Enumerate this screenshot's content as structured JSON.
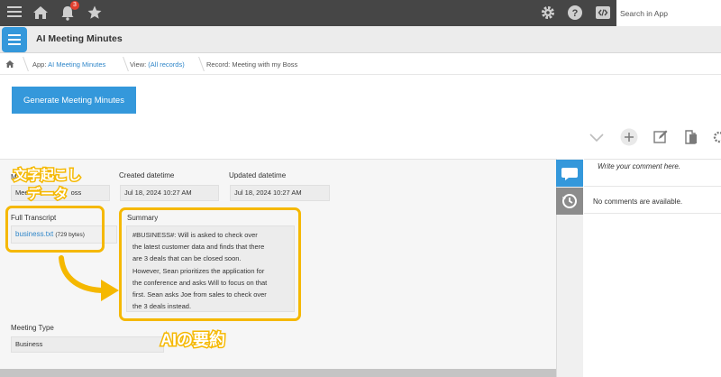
{
  "topbar": {
    "notification_count": "3",
    "search_placeholder": "Search in App",
    "icons": [
      "menu-icon",
      "home-icon",
      "bell-icon",
      "star-icon",
      "gear-icon",
      "help-icon",
      "code-icon"
    ]
  },
  "app": {
    "title": "AI Meeting Minutes",
    "accent_color": "#3498db"
  },
  "breadcrumb": {
    "app_prefix": "App: ",
    "app_name": "AI Meeting Minutes",
    "view_prefix": "View: ",
    "view_name": "(All records)",
    "record": "Record: Meeting with my Boss"
  },
  "actions": {
    "generate_label": "Generate Meeting Minutes"
  },
  "record": {
    "title_label_visible": "M",
    "title_value_visible": "Mee",
    "title_value_tail": "oss",
    "created_label": "Created datetime",
    "created_value": "Jul 18, 2024 10:27 AM",
    "updated_label": "Updated datetime",
    "updated_value": "Jul 18, 2024 10:27 AM",
    "transcript_label": "Full Transcript",
    "transcript_file": "business.txt",
    "transcript_size": "(729 bytes)",
    "summary_label": "Summary",
    "summary_lines": [
      "#BUSINESS#: Will is asked to check over",
      "the latest customer data and finds that there",
      "are 3 deals that can be closed soon.",
      "However, Sean prioritizes the application for",
      "the conference and asks Will to focus on that",
      "first. Sean asks Joe from sales to check over",
      "the 3 deals instead."
    ],
    "meeting_type_label": "Meeting Type",
    "meeting_type_value": "Business"
  },
  "annotations": {
    "transcript_note_line1": "文字起こし",
    "transcript_note_line2": "データ",
    "summary_note": "AIの要約",
    "highlight_color": "#f5b800"
  },
  "comments": {
    "input_placeholder": "Write your comment here.",
    "empty_text": "No comments are available."
  }
}
